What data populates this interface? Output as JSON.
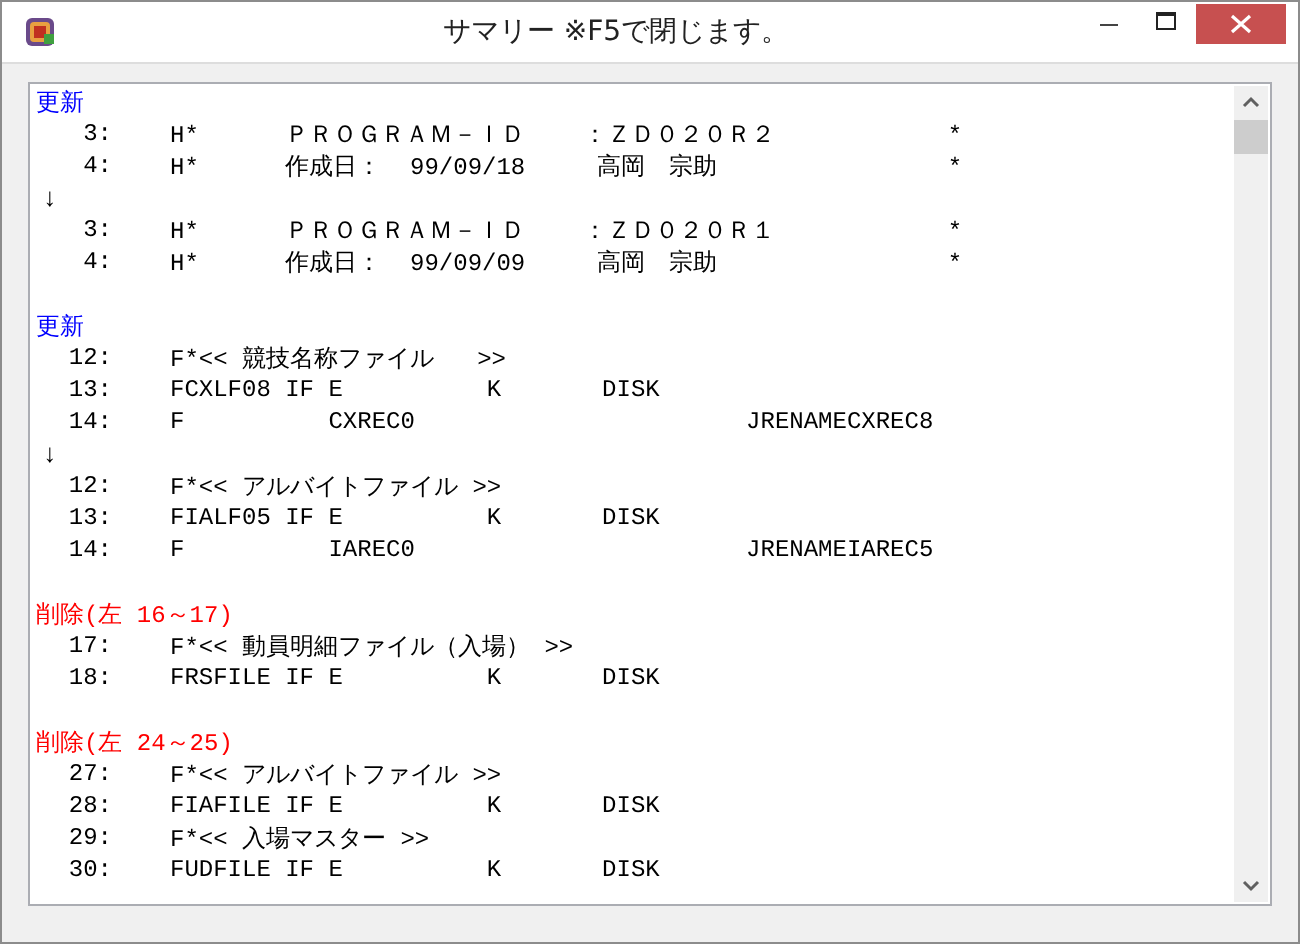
{
  "window": {
    "title": "サマリー ※F5で閉じます。"
  },
  "lines": [
    {
      "kind": "heading",
      "text": "更新",
      "color": "#0000ff"
    },
    {
      "kind": "code",
      "num": "3:",
      "text": "H*      ＰＲＯＧＲＡＭ－ＩＤ    ：ＺＤ０２０Ｒ２            *"
    },
    {
      "kind": "code",
      "num": "4:",
      "text": "H*      作成日：  99/09/18     高岡　宗助                *"
    },
    {
      "kind": "arrow",
      "text": "↓"
    },
    {
      "kind": "code",
      "num": "3:",
      "text": "H*      ＰＲＯＧＲＡＭ－ＩＤ    ：ＺＤ０２０Ｒ１            *"
    },
    {
      "kind": "code",
      "num": "4:",
      "text": "H*      作成日：  99/09/09     高岡　宗助                *"
    },
    {
      "kind": "blank"
    },
    {
      "kind": "heading",
      "text": "更新",
      "color": "#0000ff"
    },
    {
      "kind": "code",
      "num": "12:",
      "text": "F*<< 競技名称ファイル   >>"
    },
    {
      "kind": "code",
      "num": "13:",
      "text": "FCXLF08 IF E          K       DISK"
    },
    {
      "kind": "code",
      "num": "14:",
      "text": "F          CXREC0                       JRENAMECXREC8"
    },
    {
      "kind": "arrow",
      "text": "↓"
    },
    {
      "kind": "code",
      "num": "12:",
      "text": "F*<< アルバイトファイル >>"
    },
    {
      "kind": "code",
      "num": "13:",
      "text": "FIALF05 IF E          K       DISK"
    },
    {
      "kind": "code",
      "num": "14:",
      "text": "F          IAREC0                       JRENAMEIAREC5"
    },
    {
      "kind": "blank"
    },
    {
      "kind": "heading",
      "text": "削除(左 16～17)",
      "color": "#ff0000"
    },
    {
      "kind": "code",
      "num": "17:",
      "text": "F*<< 動員明細ファイル（入場） >>"
    },
    {
      "kind": "code",
      "num": "18:",
      "text": "FRSFILE IF E          K       DISK"
    },
    {
      "kind": "blank"
    },
    {
      "kind": "heading",
      "text": "削除(左 24～25)",
      "color": "#ff0000"
    },
    {
      "kind": "code",
      "num": "27:",
      "text": "F*<< アルバイトファイル >>"
    },
    {
      "kind": "code",
      "num": "28:",
      "text": "FIAFILE IF E          K       DISK"
    },
    {
      "kind": "code",
      "num": "29:",
      "text": "F*<< 入場マスター >>"
    },
    {
      "kind": "code",
      "num": "30:",
      "text": "FUDFILE IF E          K       DISK"
    }
  ]
}
